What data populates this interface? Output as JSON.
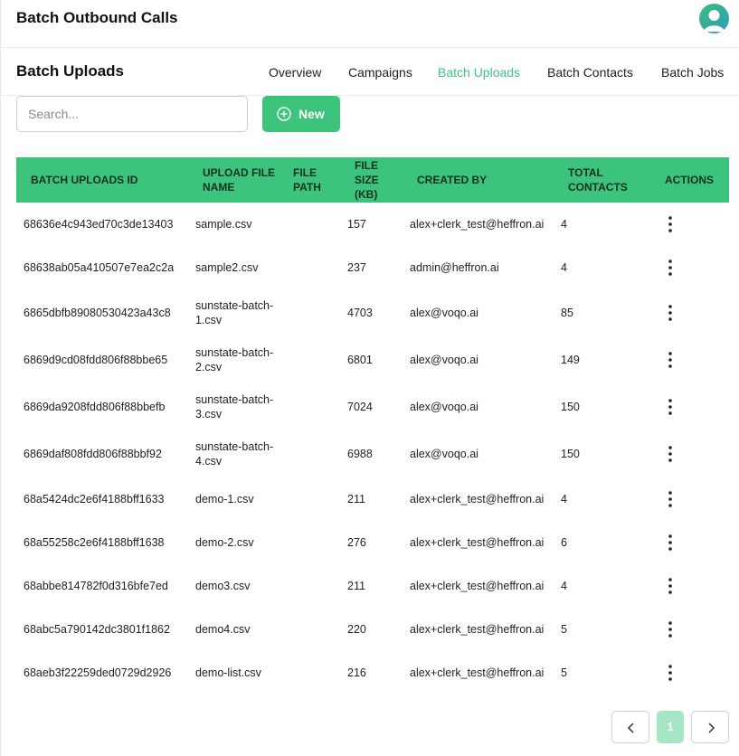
{
  "app": {
    "title": "Batch Outbound Calls"
  },
  "section": {
    "title": "Batch Uploads"
  },
  "tabs": [
    {
      "label": "Overview"
    },
    {
      "label": "Campaigns"
    },
    {
      "label": "Batch Uploads",
      "active": true
    },
    {
      "label": "Batch Contacts"
    },
    {
      "label": "Batch Jobs"
    }
  ],
  "toolbar": {
    "search_placeholder": "Search...",
    "search_value": "",
    "new_label": "New"
  },
  "table": {
    "headers": {
      "id": "BATCH UPLOADS ID",
      "name": "UPLOAD FILE NAME",
      "path": "FILE PATH",
      "size": "FILE SIZE (KB)",
      "created": "CREATED BY",
      "total": "TOTAL CONTACTS",
      "actions": "ACTIONS"
    },
    "rows": [
      {
        "id": "68636e4c943ed70c3de13403",
        "name": "sample.csv",
        "path": "",
        "size": "157",
        "created": "alex+clerk_test@heffron.ai",
        "total": "4"
      },
      {
        "id": "68638ab05a410507e7ea2c2a",
        "name": "sample2.csv",
        "path": "",
        "size": "237",
        "created": "admin@heffron.ai",
        "total": "4"
      },
      {
        "id": "6865dbfb89080530423a43c8",
        "name": "sunstate-batch-1.csv",
        "path": "",
        "size": "4703",
        "created": "alex@voqo.ai",
        "total": "85"
      },
      {
        "id": "6869d9cd08fdd806f88bbe65",
        "name": "sunstate-batch-2.csv",
        "path": "",
        "size": "6801",
        "created": "alex@voqo.ai",
        "total": "149"
      },
      {
        "id": "6869da9208fdd806f88bbefb",
        "name": "sunstate-batch-3.csv",
        "path": "",
        "size": "7024",
        "created": "alex@voqo.ai",
        "total": "150"
      },
      {
        "id": "6869daf808fdd806f88bbf92",
        "name": "sunstate-batch-4.csv",
        "path": "",
        "size": "6988",
        "created": "alex@voqo.ai",
        "total": "150"
      },
      {
        "id": "68a5424dc2e6f4188bff1633",
        "name": "demo-1.csv",
        "path": "",
        "size": "211",
        "created": "alex+clerk_test@heffron.ai",
        "total": "4"
      },
      {
        "id": "68a55258c2e6f4188bff1638",
        "name": "demo-2.csv",
        "path": "",
        "size": "276",
        "created": "alex+clerk_test@heffron.ai",
        "total": "6"
      },
      {
        "id": "68abbe814782f0d316bfe7ed",
        "name": "demo3.csv",
        "path": "",
        "size": "211",
        "created": "alex+clerk_test@heffron.ai",
        "total": "4"
      },
      {
        "id": "68abc5a790142dc3801f1862",
        "name": "demo4.csv",
        "path": "",
        "size": "220",
        "created": "alex+clerk_test@heffron.ai",
        "total": "5"
      },
      {
        "id": "68aeb3f22259ded0729d2926",
        "name": "demo-list.csv",
        "path": "",
        "size": "216",
        "created": "alex+clerk_test@heffron.ai",
        "total": "5"
      }
    ]
  },
  "pagination": {
    "current_page": "1"
  },
  "colors": {
    "accent": "#3cc47c",
    "accent_light": "#a6e6c4"
  },
  "icons": {
    "new": "plus-circle-icon",
    "row_actions": "vertical-dots-icon",
    "prev": "chevron-left-icon",
    "next": "chevron-right-icon",
    "avatar": "user-avatar-icon"
  }
}
